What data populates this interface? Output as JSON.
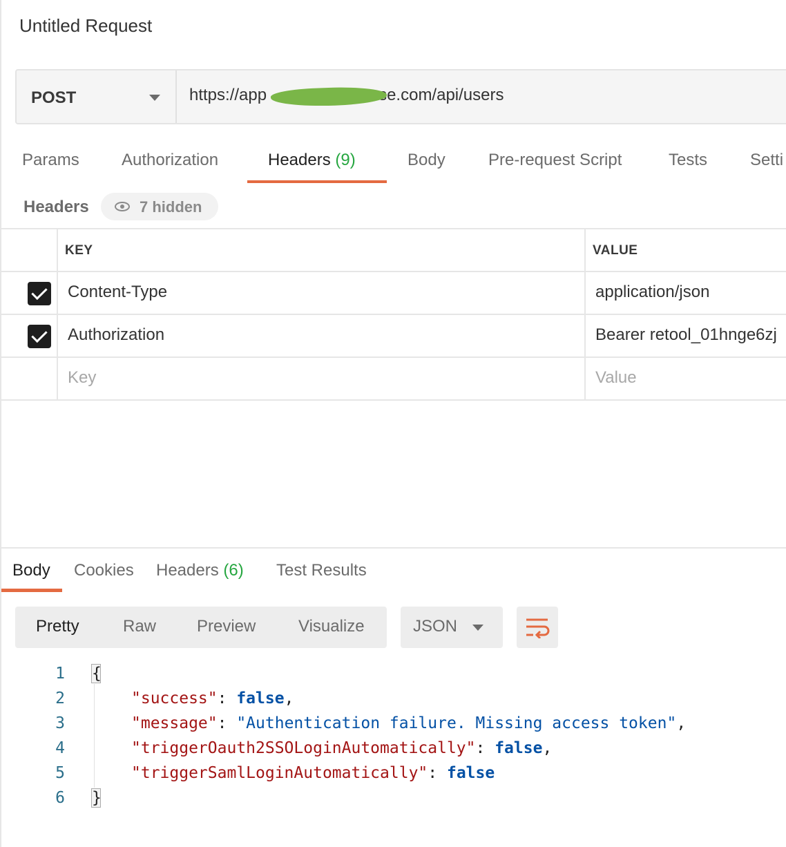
{
  "title": "Untitled Request",
  "request": {
    "method": "POST",
    "url_prefix": "https://app",
    "url_suffix": "se.com/api/users"
  },
  "request_tabs": [
    {
      "label": "Params"
    },
    {
      "label": "Authorization"
    },
    {
      "label": "Headers",
      "count": "(9)"
    },
    {
      "label": "Body"
    },
    {
      "label": "Pre-request Script"
    },
    {
      "label": "Tests"
    },
    {
      "label": "Setti"
    }
  ],
  "headers_section": {
    "label": "Headers",
    "hidden_count": "7 hidden"
  },
  "headers_table": {
    "columns": [
      "KEY",
      "VALUE"
    ],
    "rows": [
      {
        "key": "Content-Type",
        "value": "application/json",
        "checked": true
      },
      {
        "key": "Authorization",
        "value": "Bearer retool_01hnge6zj",
        "checked": true
      }
    ],
    "placeholder": {
      "key": "Key",
      "value": "Value"
    }
  },
  "response_tabs": [
    {
      "label": "Body"
    },
    {
      "label": "Cookies"
    },
    {
      "label": "Headers",
      "count": "(6)"
    },
    {
      "label": "Test Results"
    }
  ],
  "view_modes": [
    "Pretty",
    "Raw",
    "Preview",
    "Visualize"
  ],
  "format": "JSON",
  "wrap_icon": "wrap-lines-icon",
  "response_lines": [
    {
      "n": "1",
      "open": "{"
    },
    {
      "n": "2",
      "key": "\"success\"",
      "value": "false",
      "type": "bool",
      "comma": ","
    },
    {
      "n": "3",
      "key": "\"message\"",
      "value": "\"Authentication failure. Missing access token\"",
      "type": "string",
      "comma": ","
    },
    {
      "n": "4",
      "key": "\"triggerOauth2SSOLoginAutomatically\"",
      "value": "false",
      "type": "bool",
      "comma": ","
    },
    {
      "n": "5",
      "key": "\"triggerSamlLoginAutomatically\"",
      "value": "false",
      "type": "bool",
      "comma": ""
    },
    {
      "n": "6",
      "close": "}"
    }
  ],
  "colors": {
    "accent": "#e46a41",
    "count_green": "#26a640",
    "json_key": "#a31515",
    "json_value": "#0451a5"
  }
}
